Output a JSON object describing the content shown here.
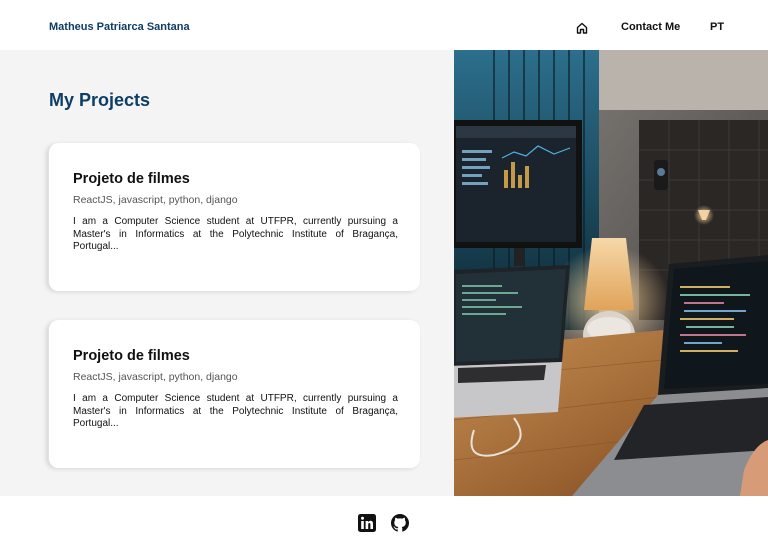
{
  "header": {
    "brand": "Matheus Patriarca Santana",
    "nav": {
      "home_icon": "home-icon",
      "contact_label": "Contact Me",
      "language_label": "PT"
    }
  },
  "main": {
    "title": "My Projects",
    "projects": [
      {
        "title": "Projeto de filmes",
        "tags": "ReactJS, javascript, python, django",
        "description": "I am a Computer Science student at UTFPR, currently pursuing a Master's in Informatics at the Polytechnic Institute of Bragança, Portugal..."
      },
      {
        "title": "Projeto de filmes",
        "tags": "ReactJS, javascript, python, django",
        "description": "I am a Computer Science student at UTFPR, currently pursuing a Master's in Informatics at the Polytechnic Institute of Bragança, Portugal..."
      }
    ],
    "photo_subject": "desk with laptops, monitor and lamp"
  },
  "footer": {
    "social_icons": [
      "linkedin-icon",
      "github-icon"
    ]
  },
  "colors": {
    "brand": "#0e3d66",
    "panel_bg": "#f4f4f4",
    "card_bg": "#ffffff"
  }
}
